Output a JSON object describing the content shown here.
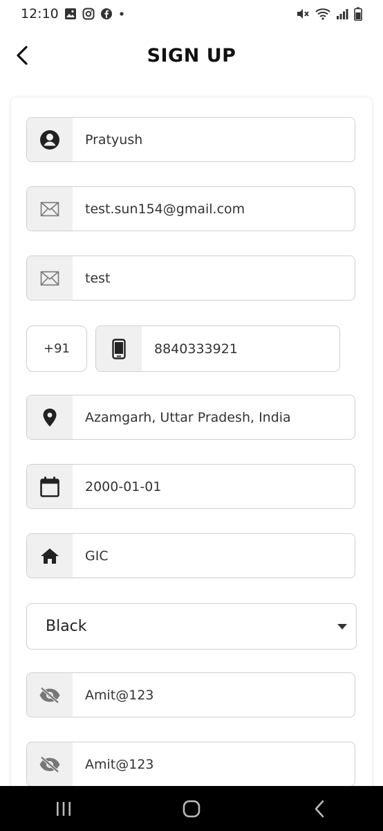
{
  "status_bar": {
    "time": "12:10",
    "icons_left": [
      "gallery-icon",
      "instagram-icon",
      "facebook-icon",
      "dot-icon"
    ],
    "icons_right": [
      "mute-icon",
      "wifi-icon",
      "signal-icon",
      "battery-icon"
    ]
  },
  "header": {
    "title": "SIGN UP",
    "back_icon": "chevron-left-icon"
  },
  "form": {
    "name": {
      "icon": "user-circle-icon",
      "value": "Pratyush"
    },
    "email": {
      "icon": "envelope-icon",
      "value": "test.sun154@gmail.com"
    },
    "email2": {
      "icon": "envelope-icon",
      "value": "test"
    },
    "country_code": {
      "value": "+91"
    },
    "phone": {
      "icon": "mobile-phone-icon",
      "value": "8840333921"
    },
    "location": {
      "icon": "location-pin-icon",
      "value": "Azamgarh, Uttar Pradesh, India"
    },
    "dob": {
      "icon": "calendar-icon",
      "value": "2000-01-01"
    },
    "school": {
      "icon": "home-icon",
      "value": "GIC"
    },
    "select": {
      "value": "Black",
      "icon": "caret-down-icon"
    },
    "password": {
      "icon": "eye-off-icon",
      "value": "Amit@123"
    },
    "confirm_password": {
      "icon": "eye-off-icon",
      "value": "Amit@123"
    }
  },
  "nav_bar": {
    "icons": [
      "recent-apps-icon",
      "home-button-icon",
      "back-nav-icon"
    ]
  },
  "colors": {
    "icon_cell_bg": "#f0f0f0",
    "border": "#cfcfcf",
    "nav_bg": "#000000"
  }
}
